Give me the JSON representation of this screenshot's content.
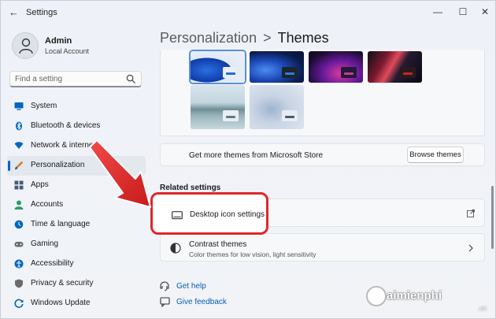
{
  "window": {
    "title": "Settings",
    "controls": {
      "minimize": "—",
      "maximize": "☐",
      "close": "✕"
    }
  },
  "profile": {
    "name": "Admin",
    "account": "Local Account"
  },
  "search": {
    "placeholder": "Find a setting"
  },
  "nav": {
    "items": [
      {
        "label": "System",
        "icon": "monitor-icon",
        "color": "#0067c0"
      },
      {
        "label": "Bluetooth & devices",
        "icon": "bluetooth-icon",
        "color": "#0067c0"
      },
      {
        "label": "Network & internet",
        "icon": "wifi-icon",
        "color": "#0067c0"
      },
      {
        "label": "Personalization",
        "icon": "brush-icon",
        "color": "#c45a1c",
        "active": true
      },
      {
        "label": "Apps",
        "icon": "apps-icon",
        "color": "#4a5a78"
      },
      {
        "label": "Accounts",
        "icon": "person-icon",
        "color": "#2a9a6a"
      },
      {
        "label": "Time & language",
        "icon": "globe-clock-icon",
        "color": "#0067c0"
      },
      {
        "label": "Gaming",
        "icon": "controller-icon",
        "color": "#6b6b6b"
      },
      {
        "label": "Accessibility",
        "icon": "accessibility-icon",
        "color": "#0067c0"
      },
      {
        "label": "Privacy & security",
        "icon": "shield-icon",
        "color": "#6b6b6b"
      },
      {
        "label": "Windows Update",
        "icon": "update-icon",
        "color": "#0067c0"
      }
    ]
  },
  "breadcrumb": {
    "parent": "Personalization",
    "separator": ">",
    "current": "Themes"
  },
  "themes": {
    "store_text": "Get more themes from Microsoft Store",
    "browse_label": "Browse themes"
  },
  "related": {
    "heading": "Related settings",
    "desktop_icon_label": "Desktop icon settings",
    "contrast_title": "Contrast themes",
    "contrast_sub": "Color themes for low vision, light sensitivity"
  },
  "links": {
    "help": "Get help",
    "feedback": "Give feedback"
  },
  "watermark": {
    "brand": "aimienphi",
    "tld": ".vn"
  }
}
